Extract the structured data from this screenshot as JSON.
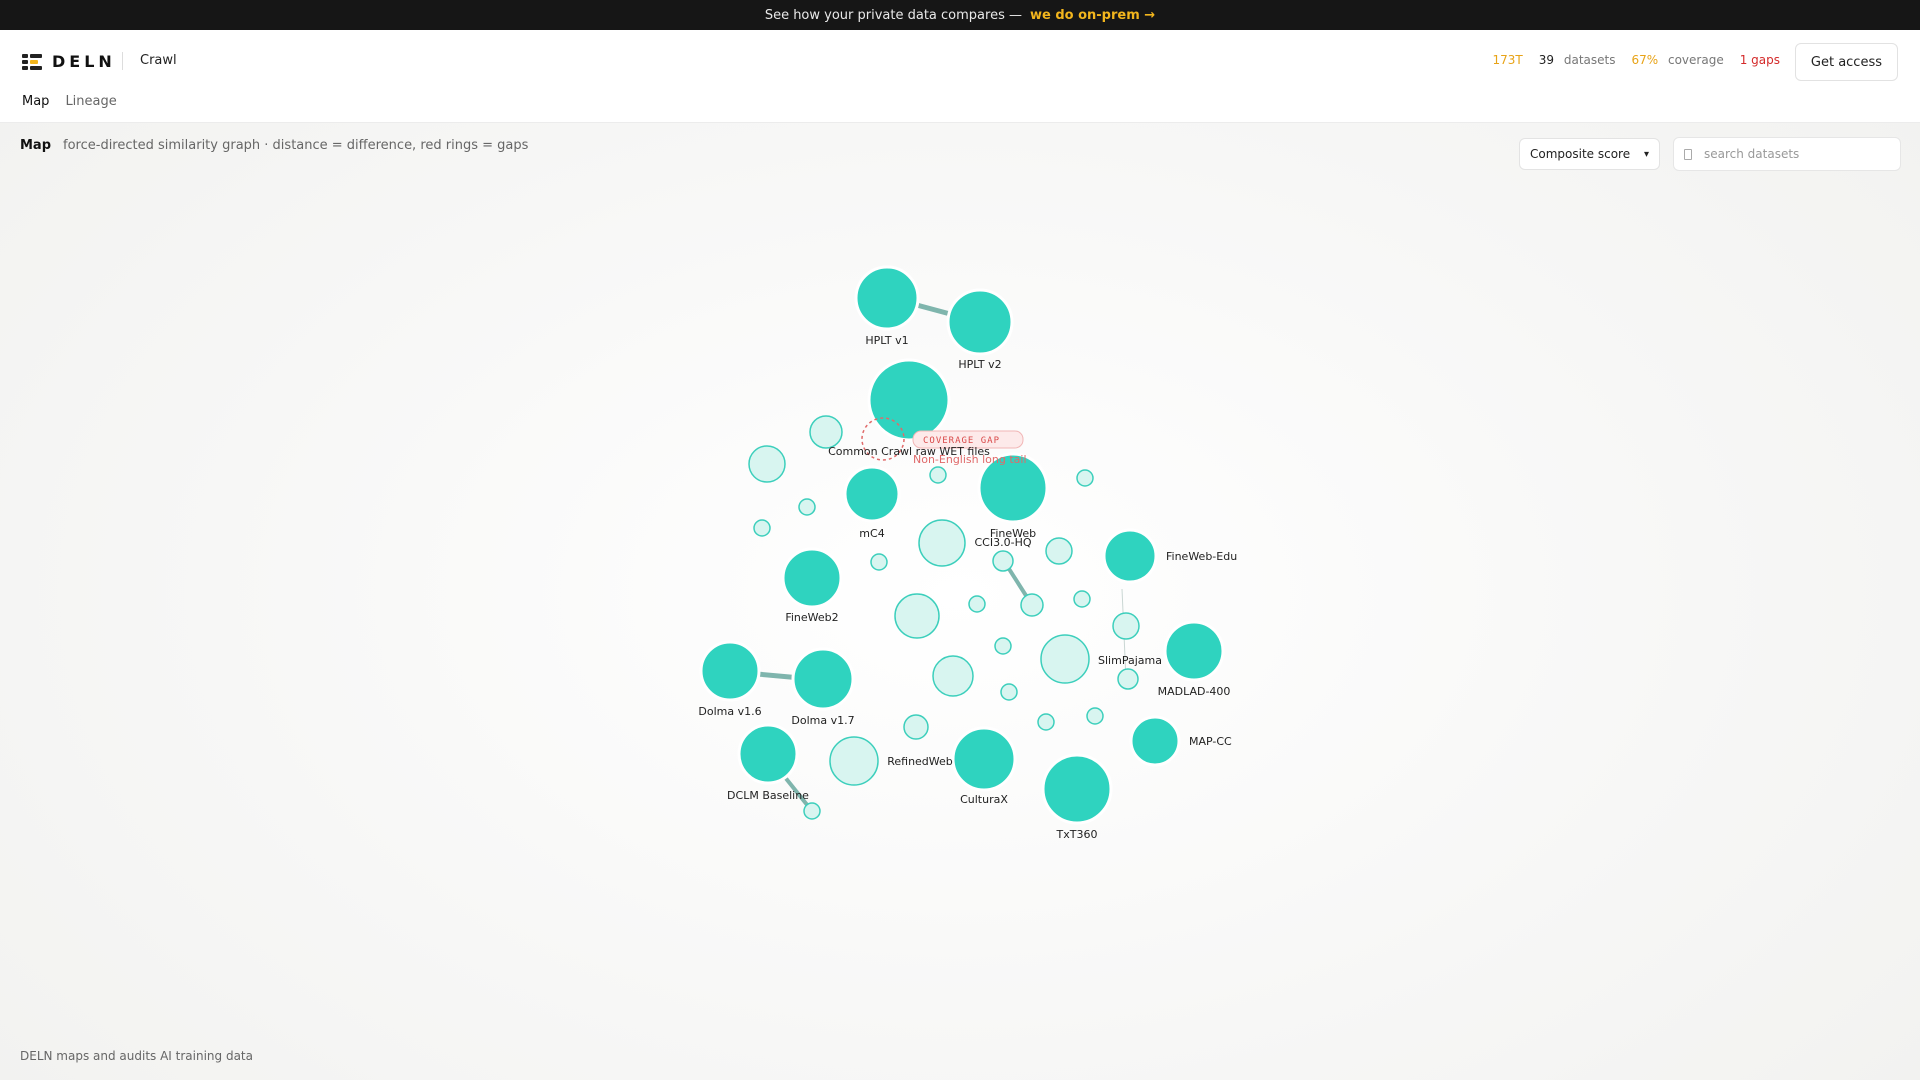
{
  "promo": {
    "text": "See how your private data compares —",
    "cta": "we do on-prem →"
  },
  "header": {
    "brand": "DELN",
    "crumb": "Crawl",
    "stats": {
      "tokens": "173T",
      "datasets_count": "39",
      "datasets_label": "datasets",
      "coverage_value": "67%",
      "coverage_label": "coverage",
      "gaps": "1 gaps"
    },
    "access_button": "Get access"
  },
  "tabs": [
    "Map",
    "Lineage"
  ],
  "map": {
    "title": "Map",
    "description": "force-directed similarity graph · distance = difference, red rings = gaps",
    "sort_select": "Composite score",
    "search_placeholder": "search datasets"
  },
  "gap_annotation": {
    "badge": "COVERAGE GAP",
    "note": "Non-English long tail"
  },
  "colors": {
    "primary_node": "#2fd3bf",
    "minor_node": "#d8f5f0",
    "edge": "#7fb5ad",
    "gap": "#e06a6a",
    "accent_yellow": "#e8a317",
    "gap_red": "#d42a2a"
  },
  "datasets": [
    "HPLT v1",
    "HPLT v2",
    "Common Crawl raw WET files",
    "FineWeb",
    "mC4",
    "CCI3.0-HQ",
    "FineWeb-Edu",
    "FineWeb2",
    "SlimPajama",
    "MADLAD-400",
    "Dolma v1.6",
    "Dolma v1.7",
    "MAP-CC",
    "RefinedWeb",
    "DCLM Baseline",
    "CulturaX",
    "TxT360"
  ],
  "footer": "DELN maps and audits AI training data"
}
